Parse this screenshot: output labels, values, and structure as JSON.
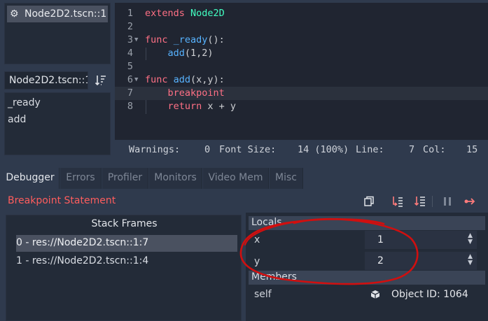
{
  "scene_list": {
    "items": [
      {
        "label": "Node2D2.tscn::1",
        "icon": "gear-icon"
      }
    ]
  },
  "script_panel": {
    "current_script": "Node2D2.tscn::1",
    "methods": [
      "_ready",
      "add"
    ]
  },
  "editor": {
    "lines": [
      {
        "n": "1",
        "fold": "",
        "tokens": [
          {
            "c": "kw",
            "t": "extends "
          },
          {
            "c": "ty",
            "t": "Node2D"
          }
        ]
      },
      {
        "n": "2",
        "fold": "",
        "tokens": []
      },
      {
        "n": "3",
        "fold": "v",
        "tokens": [
          {
            "c": "kw",
            "t": "func "
          },
          {
            "c": "fn",
            "t": "_ready"
          },
          {
            "c": "plain",
            "t": "():"
          }
        ]
      },
      {
        "n": "4",
        "fold": "",
        "tokens": [
          {
            "c": "plain",
            "t": "    "
          },
          {
            "c": "fn",
            "t": "add"
          },
          {
            "c": "plain",
            "t": "(1,2)"
          }
        ]
      },
      {
        "n": "5",
        "fold": "",
        "tokens": []
      },
      {
        "n": "6",
        "fold": "v",
        "tokens": [
          {
            "c": "kw",
            "t": "func "
          },
          {
            "c": "fn",
            "t": "add"
          },
          {
            "c": "plain",
            "t": "(x,y):"
          }
        ]
      },
      {
        "n": "7",
        "fold": "",
        "current": true,
        "tokens": [
          {
            "c": "plain",
            "t": "    "
          },
          {
            "c": "kw",
            "t": "breakpoint"
          }
        ]
      },
      {
        "n": "8",
        "fold": "",
        "tokens": [
          {
            "c": "plain",
            "t": "    "
          },
          {
            "c": "kw",
            "t": "return "
          },
          {
            "c": "plain",
            "t": "x + y"
          }
        ]
      }
    ]
  },
  "status": {
    "warnings_label": "Warnings:",
    "warnings_value": "0",
    "font_size_label": "Font Size:",
    "font_size_value": "14 (100%)",
    "line_label": "Line:",
    "line_value": "7",
    "col_label": "Col:",
    "col_value": "15"
  },
  "bottom_tabs": [
    "Debugger",
    "Errors",
    "Profiler",
    "Monitors",
    "Video Mem",
    "Misc"
  ],
  "debugger": {
    "status_text": "Breakpoint Statement",
    "stack_title": "Stack Frames",
    "frames": [
      "0 - res://Node2D2.tscn::1:7",
      "1 - res://Node2D2.tscn::1:4"
    ],
    "locals_header": "Locals",
    "locals": [
      {
        "name": "x",
        "value": "1"
      },
      {
        "name": "y",
        "value": "2"
      }
    ],
    "members_header": "Members",
    "members": [
      {
        "name": "self",
        "value": "Object ID: 1064"
      }
    ]
  },
  "colors": {
    "accent_error": "#ff5d5d",
    "keyword": "#ff7085",
    "function": "#57b3ff",
    "type": "#42ffc2",
    "annotation_circle": "#d10f0f"
  }
}
